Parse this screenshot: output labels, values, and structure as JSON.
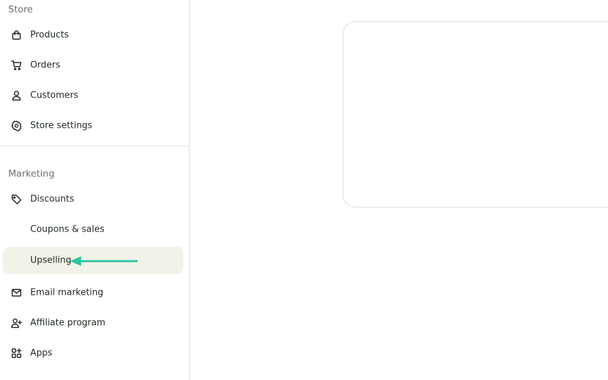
{
  "sidebar": {
    "sections": {
      "store": "Store",
      "marketing": "Marketing"
    },
    "items": [
      {
        "id": "products",
        "label": "Products",
        "icon": "shopping-bag-icon"
      },
      {
        "id": "orders",
        "label": "Orders",
        "icon": "cart-icon"
      },
      {
        "id": "customers",
        "label": "Customers",
        "icon": "user-icon"
      },
      {
        "id": "store-settings",
        "label": "Store settings",
        "icon": "gear-icon"
      },
      {
        "id": "discounts",
        "label": "Discounts",
        "icon": "tag-icon"
      },
      {
        "id": "coupons-sales",
        "label": "Coupons & sales",
        "icon": ""
      },
      {
        "id": "upselling",
        "label": "Upselling",
        "icon": "",
        "active": true
      },
      {
        "id": "email-marketing",
        "label": "Email marketing",
        "icon": "mail-icon"
      },
      {
        "id": "affiliate-program",
        "label": "Affiliate program",
        "icon": "user-plus-icon"
      },
      {
        "id": "apps",
        "label": "Apps",
        "icon": "apps-grid-icon"
      }
    ]
  },
  "colors": {
    "active_bg": "#f1f3e8",
    "arrow": "#2ec4a0",
    "border": "#dcdfdc",
    "text": "#1f2a1f",
    "muted": "#66706a"
  }
}
